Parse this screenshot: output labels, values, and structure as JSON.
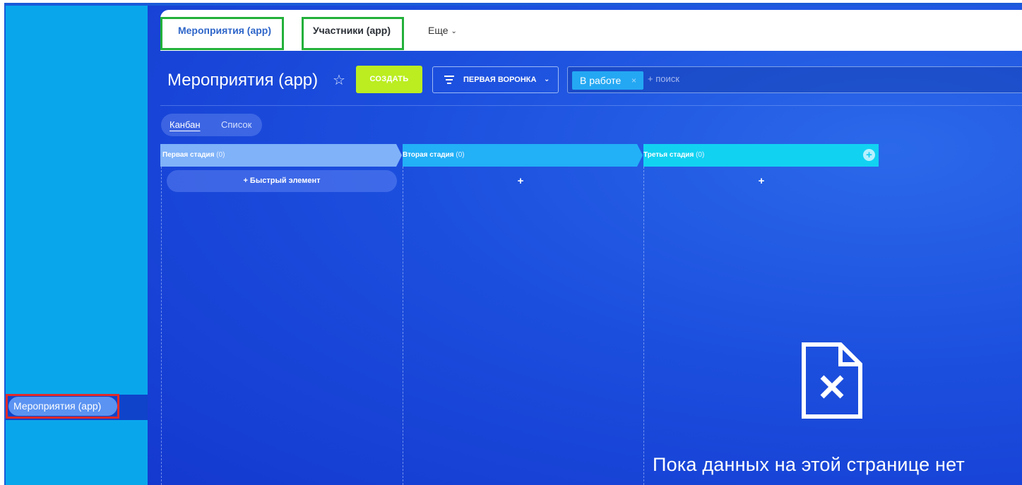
{
  "sidebar": {
    "item_label": "Мероприятия (app)"
  },
  "topbar": {
    "tabs": [
      {
        "label": "Мероприятия (app)",
        "active": true
      },
      {
        "label": "Участники (app)",
        "active": false
      }
    ],
    "more_label": "Еще"
  },
  "header": {
    "title": "Мероприятия (app)",
    "create_label": "СОЗДАТЬ",
    "funnel_label": "ПЕРВАЯ ВОРОНКА",
    "filter_chip": "В работе",
    "filter_chip_close": "×",
    "search_placeholder": "+ поиск"
  },
  "views": {
    "kanban": "Канбан",
    "list": "Список"
  },
  "kanban": {
    "stages": [
      {
        "name": "Первая стадия",
        "count": "(0)",
        "color": "#7fb2f8"
      },
      {
        "name": "Вторая стадия",
        "count": "(0)",
        "color": "#22b0f7"
      },
      {
        "name": "Третья стадия",
        "count": "(0)",
        "color": "#12d2f2"
      }
    ],
    "quick_add_label": "+  Быстрый элемент",
    "plus": "+"
  },
  "empty_state": {
    "icon": "document-x-icon",
    "text": "Пока данных на этой странице нет"
  },
  "colors": {
    "sidebar": "#0aa6ec",
    "create_button": "#bbed21",
    "tab_outline": "#22b03a",
    "sidebar_outline": "#e12a2a"
  }
}
